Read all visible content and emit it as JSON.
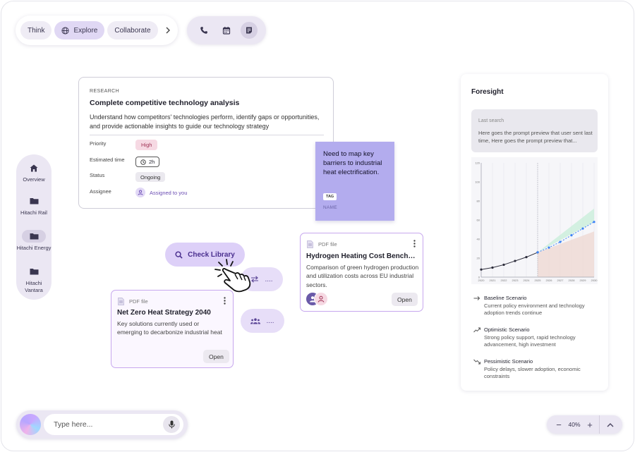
{
  "modes": {
    "think": "Think",
    "explore": "Explore",
    "collaborate": "Collaborate"
  },
  "nav": {
    "overview": "Overview",
    "rail": "Hitachi Rail",
    "energy": "Hitachi Energy",
    "vantara": "Hitachi Vantara"
  },
  "research": {
    "kicker": "RESEARCH",
    "title": "Complete competitive technology analysis",
    "description": "Understand how competitors' technologies perform, identify gaps or opportunities, and provide actionable insights to guide our technology strategy",
    "priority_label": "Priority",
    "priority_value": "High",
    "time_label": "Estimated time",
    "time_value": "2h",
    "status_label": "Status",
    "status_value": "Ongoing",
    "assignee_label": "Assignee",
    "assignee_value": "Assigned to you"
  },
  "sticky": {
    "text": "Need to map key barriers to industrial heat electrification.",
    "tag": "TAG",
    "name": "NAME"
  },
  "check_library": "Check Library",
  "bubbles": {
    "swap_more": "....",
    "group_more": "...."
  },
  "pdf_hydrogen": {
    "type": "PDF file",
    "title": "Hydrogen Heating Cost Benchmark",
    "description": "Comparison of green hydrogen production and utilization costs across EU industrial sectors.",
    "open": "Open"
  },
  "pdf_netzero": {
    "type": "PDF file",
    "title": "Net Zero Heat Strategy 2040",
    "description": "Key solutions currently used or emerging to decarbonize industrial heat",
    "open": "Open"
  },
  "foresight": {
    "title": "Foresight",
    "last_search_label": "Last search",
    "last_search_text": "Here goes the prompt preview that user sent last time, Here goes the prompt preview that...",
    "scenarios": [
      {
        "name": "Baseline Scenario",
        "description": "Current policy environment and technology adoption trends continue",
        "icon": "arrow-right-icon"
      },
      {
        "name": "Optimistic Scenario",
        "description": "Strong policy support, rapid technology advancement, high investment",
        "icon": "trend-up-icon"
      },
      {
        "name": "Pessimistic Scenario",
        "description": "Policy delays, slower adoption, economic constraints",
        "icon": "trend-down-icon"
      }
    ]
  },
  "chart_data": {
    "type": "line",
    "x": [
      2020,
      2021,
      2022,
      2023,
      2024,
      2025,
      2026,
      2027,
      2028,
      2029,
      2030
    ],
    "x_tick_labels": [
      "2020",
      "2021",
      "2022",
      "2023",
      "2024",
      "2025",
      "2026",
      "2027",
      "2028",
      "2029",
      "2030"
    ],
    "y_tick_labels": [
      "0",
      "20",
      "40",
      "60",
      "80",
      "100",
      "120"
    ],
    "ylim": [
      0,
      120
    ],
    "xlim": [
      2020,
      2030
    ],
    "divider_x": 2025,
    "series": [
      {
        "style": "historical-solid",
        "x": [
          2020,
          2021,
          2022,
          2023,
          2024,
          2025
        ],
        "values": [
          8,
          10,
          13,
          17,
          21,
          26
        ]
      },
      {
        "style": "forecast-dotted",
        "x": [
          2025,
          2026,
          2027,
          2028,
          2029,
          2030
        ],
        "values": [
          26,
          31,
          37,
          44,
          51,
          58
        ]
      }
    ],
    "bands": [
      {
        "style": "optimistic-band",
        "x": [
          2025,
          2030
        ],
        "upper": [
          26,
          72
        ],
        "lower": [
          26,
          58
        ]
      },
      {
        "style": "pessimistic-band",
        "x": [
          2025,
          2030
        ],
        "upper": [
          26,
          48
        ],
        "lower": [
          0,
          0
        ]
      }
    ],
    "colors": {
      "historical": "#2c2c3a",
      "forecast": "#3b82f6",
      "optimistic": "#cdeedd",
      "pessimistic": "#eedad6"
    },
    "grid": true
  },
  "input": {
    "placeholder": "Type here..."
  },
  "zoom": {
    "value": "40%",
    "minus": "−",
    "plus": "+"
  },
  "colors": {
    "accent": "#6b4db3",
    "lavender": "#ebe7f3",
    "sticky": "#b3acee"
  }
}
